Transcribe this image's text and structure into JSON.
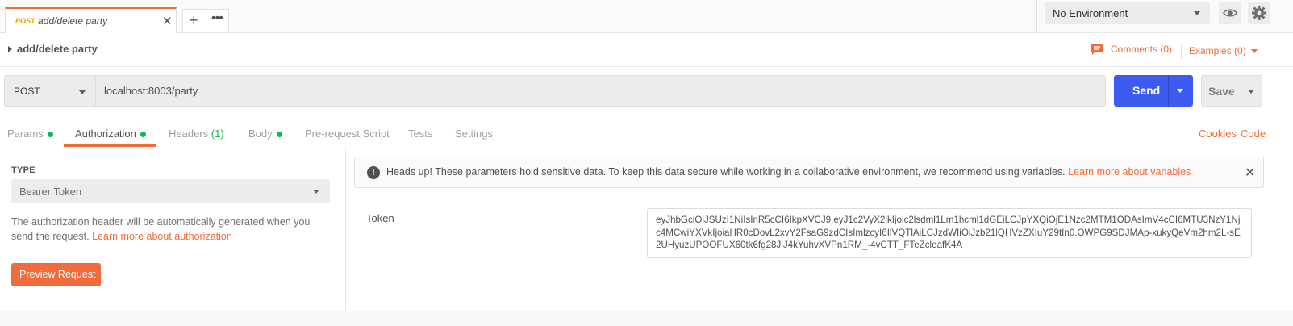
{
  "tab": {
    "method": "POST",
    "name": "add/delete party"
  },
  "environment": {
    "selected": "No Environment"
  },
  "request": {
    "title": "add/delete party",
    "comments_label": "Comments (0)",
    "examples_label": "Examples (0)",
    "method": "POST",
    "url": "localhost:8003/party",
    "send_label": "Send",
    "save_label": "Save"
  },
  "subtabs": {
    "params": "Params",
    "authorization": "Authorization",
    "headers": "Headers",
    "headers_count": "(1)",
    "body": "Body",
    "prerequest": "Pre-request Script",
    "tests": "Tests",
    "settings": "Settings",
    "cookies": "Cookies",
    "code": "Code"
  },
  "auth": {
    "type_label": "TYPE",
    "type_value": "Bearer Token",
    "description": "The authorization header will be automatically generated when you send the request.",
    "learn_more": "Learn more about authorization",
    "preview_button": "Preview Request",
    "banner_text": "Heads up! These parameters hold sensitive data. To keep this data secure while working in a collaborative environment, we recommend using variables.",
    "banner_link": "Learn more about variables",
    "token_label": "Token",
    "token_value": "eyJhbGciOiJSUzI1NiIsInR5cCI6IkpXVCJ9.eyJ1c2VyX2lkIjoic2lsdml1Lm1hcml1dGEiLCJpYXQiOjE1Nzc2MTM1ODAsImV4cCI6MTU3NzY1Njc4MCwiYXVkIjoiaHR0cDovL2xvY2FsaG9zdCIsImlzcyI6IlVQTlAiLCJzdWIiOiJzb21lQHVzZXIuY29tIn0.OWPG9SDJMAp-xukyQeVm2hm2L-sE2UHyuzUPOOFUX60tk6fg28JiJ4kYuhvXVPn1RM_-4vCTT_FTeZcleafK4A"
  }
}
